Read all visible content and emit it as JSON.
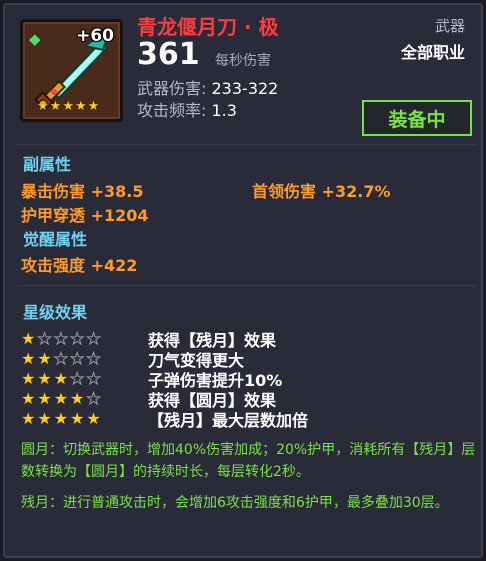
{
  "item": {
    "name": "青龙偃月刀 · 极",
    "plus": "+60",
    "rarity_stars": 5,
    "type": "武器",
    "job": "全部职业",
    "dps_value": "361",
    "dps_label": "每秒伤害",
    "damage_label": "武器伤害:",
    "damage_value": "233-322",
    "speed_label": "攻击频率:",
    "speed_value": "1.3",
    "equip_label": "装备中"
  },
  "sub_attrs": {
    "title": "副属性",
    "items": [
      "暴击伤害 +38.5",
      "首领伤害 +32.7%",
      "护甲穿透 +1204"
    ]
  },
  "awaken_attrs": {
    "title": "觉醒属性",
    "items": [
      "攻击强度 +422"
    ]
  },
  "star_effects": {
    "title": "星级效果",
    "rows": [
      {
        "stars": 1,
        "text": "获得【残月】效果"
      },
      {
        "stars": 2,
        "text": "刀气变得更大"
      },
      {
        "stars": 3,
        "text": "子弹伤害提升10%"
      },
      {
        "stars": 4,
        "text": "获得【圆月】效果"
      },
      {
        "stars": 5,
        "text": "【残月】最大层数加倍"
      }
    ]
  },
  "descriptions": [
    "圆月：切换武器时，增加40%伤害加成；20%护甲，消耗所有【残月】层数转换为【圆月】的持续时长，每层转化2秒。",
    "残月：进行普通攻击时，会增加6攻击强度和6护甲，最多叠加30层。"
  ],
  "colors": {
    "title": "#ff3b3b",
    "attr": "#ff9a2a",
    "section": "#6fd2f2",
    "equip": "#7ae04a",
    "desc": "#7ae04a",
    "star": "#ffcc1a"
  },
  "icons": [
    "sword-icon",
    "gem-icon",
    "star-icon"
  ]
}
